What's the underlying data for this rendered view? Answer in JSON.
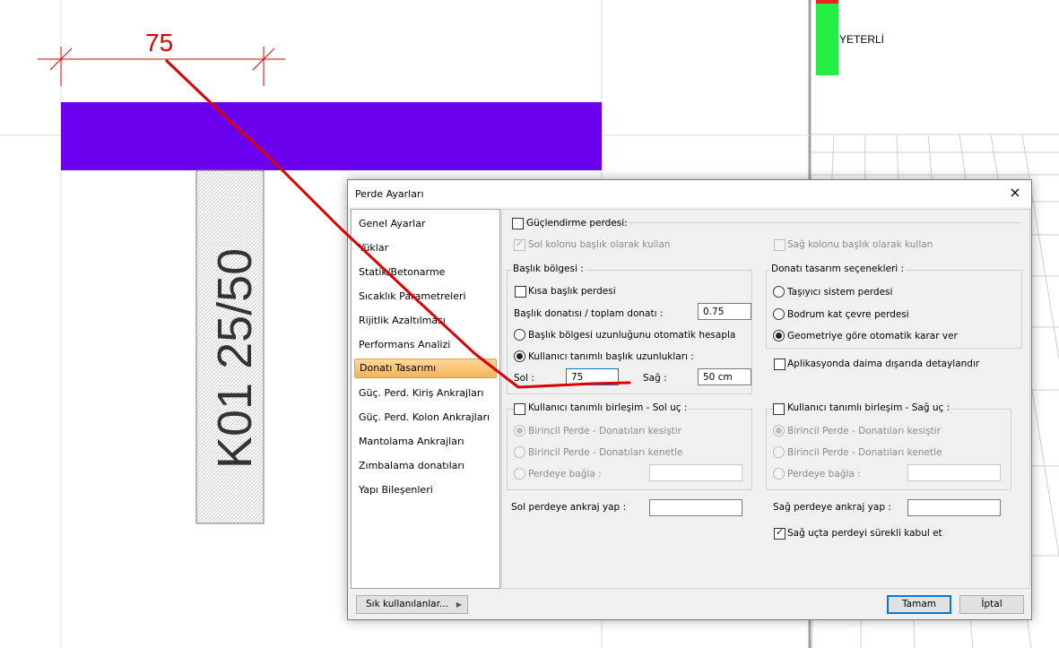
{
  "drawing": {
    "dimension_value": "75",
    "column_label": "K01 25/50",
    "status_text": "YETERLİ",
    "colors": {
      "wall": "#6a00ee",
      "status_ok": "#22ee44",
      "status_fail": "#ee2222",
      "annotation": "#dd0000"
    }
  },
  "dialog": {
    "title": "Perde Ayarları",
    "close_icon": "×",
    "nav": [
      "Genel Ayarlar",
      "Yüklar",
      "Statik/Betonarme",
      "Sıcaklık Parametreleri",
      "Rijitlik Azaltılması",
      "Performans Analizi",
      "Donatı Tasarımı",
      "Güç. Perd. Kiriş Ankrajları",
      "Güç. Perd. Kolon Ankrajları",
      "Mantolama Ankrajları",
      "Zımbalama donatıları",
      "Yapı Bileşenleri"
    ],
    "nav_selected": "Donatı Tasarımı",
    "strengthening": {
      "title": "Güçlendirme perdesi:",
      "left_col": "Sol kolonu başlık olarak kullan",
      "right_col": "Sağ kolonu başlık olarak kullan"
    },
    "header_zone": {
      "title": "Başlık bölgesi :",
      "short_header": "Kısa başlık perdesi",
      "ratio_label": "Başlık donatısı / toplam donatı :",
      "ratio_value": "0.75",
      "auto_length": "Başlık bölgesi uzunluğunu otomatik hesapla",
      "user_length": "Kullanıcı tanımlı başlık uzunlukları :",
      "left_label": "Sol :",
      "left_value": "75",
      "right_label": "Sağ :",
      "right_value": "50 cm"
    },
    "design_options": {
      "title": "Donatı tasarım seçenekleri :",
      "opt1": "Taşıyıcı sistem perdesi",
      "opt2": "Bodrum kat çevre perdesi",
      "opt3": "Geometriye göre otomatik karar ver",
      "outside_detail": "Aplikasyonda daima dışarıda detaylandır"
    },
    "left_joint": {
      "title": "Kullanıcı tanımlı birleşim - Sol uç :",
      "opt1": "Birincil Perde - Donatıları kesiştir",
      "opt2": "Birincil Perde - Donatıları kenetle",
      "opt3": "Perdeye bağla :"
    },
    "right_joint": {
      "title": "Kullanıcı tanımlı birleşim - Sağ uç :",
      "opt1": "Birincil Perde - Donatıları kesiştir",
      "opt2": "Birincil Perde - Donatıları kenetle",
      "opt3": "Perdeye bağla :"
    },
    "left_anchor": "Sol perdeye ankraj yap :",
    "right_anchor": "Sağ perdeye ankraj yap :",
    "continuous": "Sağ uçta perdeyi sürekli kabul et",
    "frequent_button": "Sık kullanılanlar...",
    "ok_button": "Tamam",
    "cancel_button": "İptal"
  }
}
